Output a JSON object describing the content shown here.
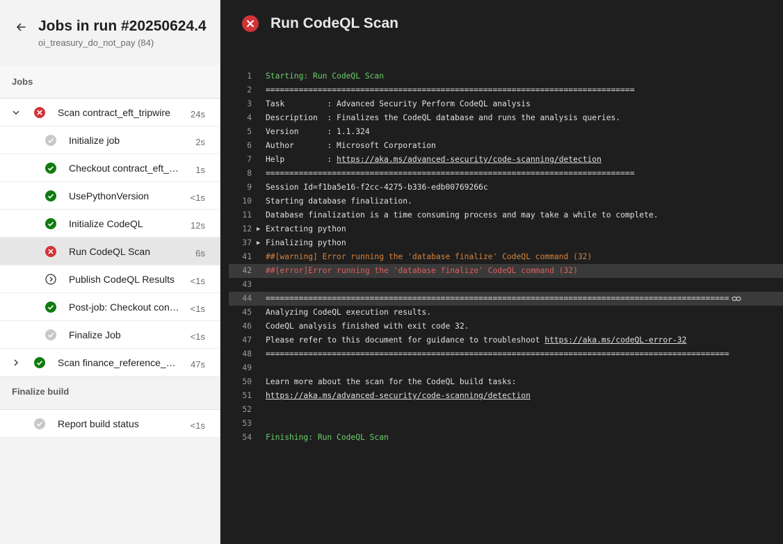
{
  "sidebar": {
    "title": "Jobs in run #20250624.4",
    "subtitle": "oi_treasury_do_not_pay (84)",
    "jobs_heading": "Jobs",
    "finalize_heading": "Finalize build",
    "jobs": [
      {
        "label": "Scan contract_eft_tripwire",
        "duration": "24s",
        "status": "failed",
        "expanded": true
      },
      {
        "label": "Initialize job",
        "duration": "2s",
        "status": "skipped"
      },
      {
        "label": "Checkout contract_eft_tripwire",
        "duration": "1s",
        "status": "succeeded"
      },
      {
        "label": "UsePythonVersion",
        "duration": "<1s",
        "status": "succeeded"
      },
      {
        "label": "Initialize CodeQL",
        "duration": "12s",
        "status": "succeeded"
      },
      {
        "label": "Run CodeQL Scan",
        "duration": "6s",
        "status": "failed",
        "selected": true
      },
      {
        "label": "Publish CodeQL Results",
        "duration": "<1s",
        "status": "skipped-step"
      },
      {
        "label": "Post-job: Checkout contract_eft_tripwire",
        "duration": "<1s",
        "status": "succeeded"
      },
      {
        "label": "Finalize Job",
        "duration": "<1s",
        "status": "skipped"
      },
      {
        "label": "Scan finance_reference_data",
        "duration": "47s",
        "status": "succeeded",
        "expanded": false
      }
    ],
    "report": {
      "label": "Report build status",
      "duration": "<1s",
      "status": "skipped"
    }
  },
  "main": {
    "title": "Run CodeQL Scan",
    "log": [
      {
        "n": "1",
        "text": "Starting: Run CodeQL Scan",
        "style": "green"
      },
      {
        "n": "2",
        "text": "=============================================================================="
      },
      {
        "n": "3",
        "text": "Task         : Advanced Security Perform CodeQL analysis"
      },
      {
        "n": "4",
        "text": "Description  : Finalizes the CodeQL database and runs the analysis queries."
      },
      {
        "n": "5",
        "text": "Version      : 1.1.324"
      },
      {
        "n": "6",
        "text": "Author       : Microsoft Corporation"
      },
      {
        "n": "7",
        "text": "Help         : ",
        "link": "https://aka.ms/advanced-security/code-scanning/detection"
      },
      {
        "n": "8",
        "text": "=============================================================================="
      },
      {
        "n": "9",
        "text": "Session Id=f1ba5e16-f2cc-4275-b336-edb00769266c"
      },
      {
        "n": "10",
        "text": "Starting database finalization."
      },
      {
        "n": "11",
        "text": "Database finalization is a time consuming process and may take a while to complete."
      },
      {
        "n": "12",
        "text": "Extracting python",
        "collapsible": true
      },
      {
        "n": "37",
        "text": "Finalizing python",
        "collapsible": true
      },
      {
        "n": "41",
        "text": "##[warning] Error running the 'database finalize' CodeQL command (32)",
        "style": "warn"
      },
      {
        "n": "42",
        "text": "##[error]Error running the 'database finalize' CodeQL command (32)",
        "style": "err",
        "highlight": true
      },
      {
        "n": "43",
        "text": ""
      },
      {
        "n": "44",
        "text": "==================================================================================================",
        "highlight": true,
        "anchor": true
      },
      {
        "n": "45",
        "text": "Analyzing CodeQL execution results."
      },
      {
        "n": "46",
        "text": "CodeQL analysis finished with exit code 32."
      },
      {
        "n": "47",
        "text": "Please refer to this document for guidance to troubleshoot ",
        "link": "https://aka.ms/codeQL-error-32"
      },
      {
        "n": "48",
        "text": "=================================================================================================="
      },
      {
        "n": "49",
        "text": ""
      },
      {
        "n": "50",
        "text": "Learn more about the scan for the CodeQL build tasks:"
      },
      {
        "n": "51",
        "text": "",
        "link": "https://aka.ms/advanced-security/code-scanning/detection"
      },
      {
        "n": "52",
        "text": ""
      },
      {
        "n": "53",
        "text": ""
      },
      {
        "n": "54",
        "text": "Finishing: Run CodeQL Scan",
        "style": "green"
      }
    ]
  },
  "colors": {
    "failed": "#d13438",
    "succeeded": "#107c10",
    "skipped": "#c8c8c8"
  }
}
